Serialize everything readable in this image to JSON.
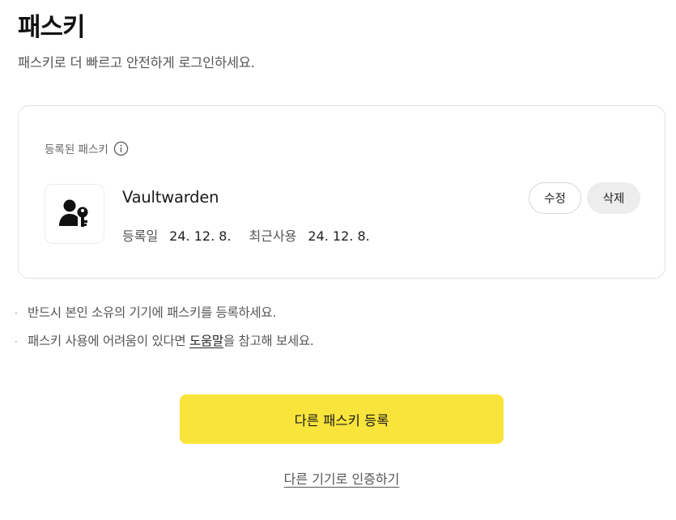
{
  "header": {
    "title": "패스키",
    "subtitle": "패스키로 더 빠르고 안전하게 로그인하세요."
  },
  "card": {
    "section_label": "등록된 패스키",
    "passkey": {
      "name": "Vaultwarden",
      "registered_label": "등록일",
      "registered_date": "24. 12. 8.",
      "last_used_label": "최근사용",
      "last_used_date": "24. 12. 8.",
      "icon": "user-key-icon"
    },
    "edit_label": "수정",
    "delete_label": "삭제"
  },
  "notes": {
    "note1": "반드시 본인 소유의 기기에 패스키를 등록하세요.",
    "note2_prefix": "패스키 사용에 어려움이 있다면 ",
    "note2_link": "도움말",
    "note2_suffix": "을 참고해 보세요."
  },
  "actions": {
    "register_label": "다른 패스키 등록",
    "other_device_label": "다른 기기로 인증하기"
  },
  "colors": {
    "accent_yellow": "#f9e43b",
    "delete_bg": "#ededed"
  }
}
